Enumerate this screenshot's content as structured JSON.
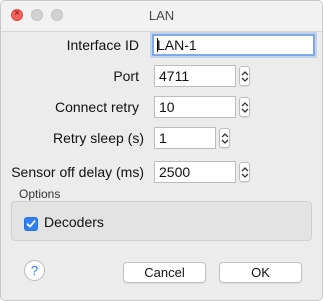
{
  "window": {
    "title": "LAN",
    "close_glyph": "×"
  },
  "fields": {
    "interface_id": {
      "label": "Interface ID",
      "value": "LAN-1"
    },
    "port": {
      "label": "Port",
      "value": "4711"
    },
    "connect_retry": {
      "label": "Connect retry",
      "value": "10"
    },
    "retry_sleep": {
      "label": "Retry sleep (s)",
      "value": "1"
    },
    "sensor_off_delay": {
      "label": "Sensor off delay (ms)",
      "value": "2500"
    }
  },
  "options": {
    "section_label": "Options",
    "decoders": {
      "label": "Decoders",
      "checked": true
    }
  },
  "footer": {
    "help_label": "?",
    "cancel_label": "Cancel",
    "ok_label": "OK"
  },
  "colors": {
    "accent": "#2f7ff5",
    "focus_ring": "#7fa9e8",
    "close_button": "#fc605b"
  },
  "icons": {
    "stepper": "chevron-up-down-icon",
    "check": "checkmark-icon",
    "help": "help-icon"
  }
}
